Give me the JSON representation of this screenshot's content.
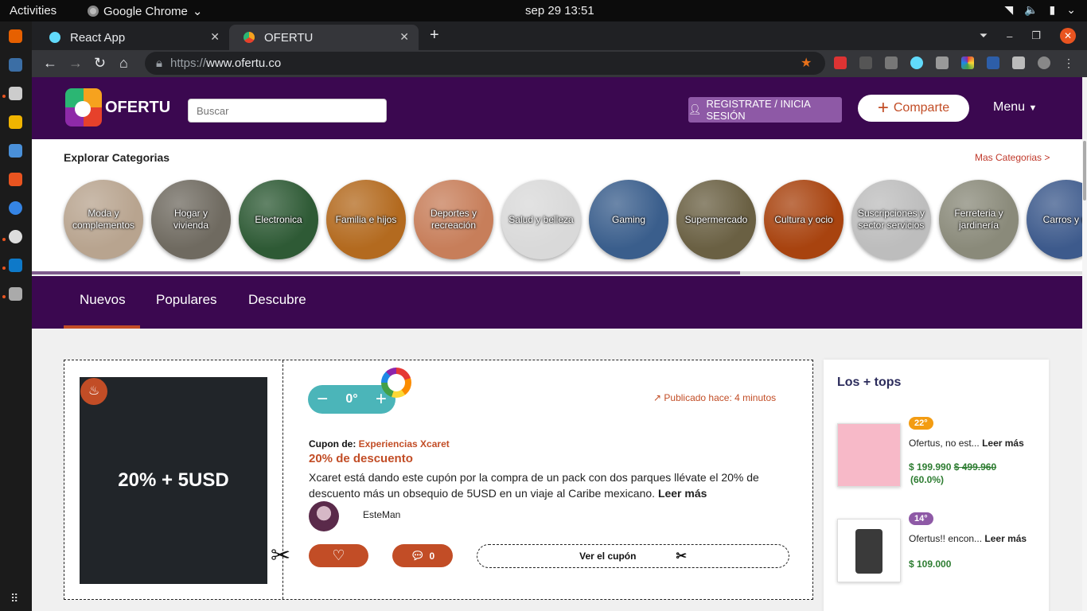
{
  "system": {
    "activities": "Activities",
    "app_name": "Google Chrome",
    "clock": "sep 29  13:51"
  },
  "browser": {
    "tabs": [
      {
        "title": "React App",
        "active": false
      },
      {
        "title": "OFERTU",
        "active": true
      }
    ],
    "url_scheme": "https://",
    "url_host": "www.ofertu.co"
  },
  "header": {
    "logo_text": "OFERTU",
    "search_placeholder": "Buscar",
    "register_label": "REGISTRATE / INICIA SESIÓN",
    "share_label": "Comparte",
    "menu_label": "Menu"
  },
  "categories": {
    "title": "Explorar Categorias",
    "more_link": "Mas Categorias >",
    "items": [
      {
        "label": "Moda y complementos",
        "color": "#b8a48f"
      },
      {
        "label": "Hogar y vivienda",
        "color": "#6f6a60"
      },
      {
        "label": "Electronica",
        "color": "#2e5a35"
      },
      {
        "label": "Familia e hijos",
        "color": "#b36a1f"
      },
      {
        "label": "Deportes y recreación",
        "color": "#c77e5a"
      },
      {
        "label": "Salud y belleza",
        "color": "#d9d9d9"
      },
      {
        "label": "Gaming",
        "color": "#3a5e8c"
      },
      {
        "label": "Supermercado",
        "color": "#6a6043"
      },
      {
        "label": "Cultura y ocio",
        "color": "#a8430f"
      },
      {
        "label": "Suscripciones y sector servicios",
        "color": "#bdbdbd"
      },
      {
        "label": "Ferreteria y jardinería",
        "color": "#8a8a7a"
      },
      {
        "label": "Carros y m",
        "color": "#3d5a8c"
      }
    ]
  },
  "feed_tabs": [
    "Nuevos",
    "Populares",
    "Descubre"
  ],
  "deal": {
    "image_text": "20% + 5USD",
    "votes": "0°",
    "published": "Publicado hace: 4 minutos",
    "coupon_prefix": "Cupon de:",
    "coupon_brand": "Experiencias Xcaret",
    "title": "20% de descuento",
    "description": "Xcaret está dando este cupón por la compra de un pack con dos parques llévate el 20% de descuento más un obsequio de 5USD en un viaje al Caribe mexicano.",
    "read_more": "Leer más",
    "author": "EsteMan",
    "comments": "0",
    "see_coupon": "Ver el cupón"
  },
  "tops": {
    "title": "Los + tops",
    "items": [
      {
        "badge": "22°",
        "badge_color": "#f39c12",
        "text": "Ofertus, no est...",
        "read_more": "Leer más",
        "price": "$ 199.990",
        "old_price": "$ 499.960",
        "discount": "(60.0%)",
        "thumb_color": "#f7b9c8"
      },
      {
        "badge": "14°",
        "badge_color": "#8e59a6",
        "text": "Ofertus!! encon...",
        "read_more": "Leer más",
        "price": "$ 109.000",
        "old_price": "",
        "discount": "",
        "thumb_color": "#3a3a3a"
      }
    ]
  }
}
